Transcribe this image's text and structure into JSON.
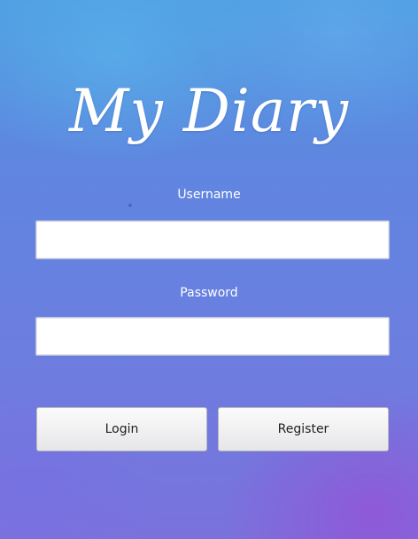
{
  "app": {
    "title": "My Diary"
  },
  "form": {
    "username_label": "Username",
    "username_value": "",
    "password_label": "Password",
    "password_value": ""
  },
  "actions": {
    "login_label": "Login",
    "register_label": "Register"
  },
  "colors": {
    "background_top": "#4f9ee2",
    "background_bottom": "#7a72dc",
    "text": "#ffffff"
  }
}
